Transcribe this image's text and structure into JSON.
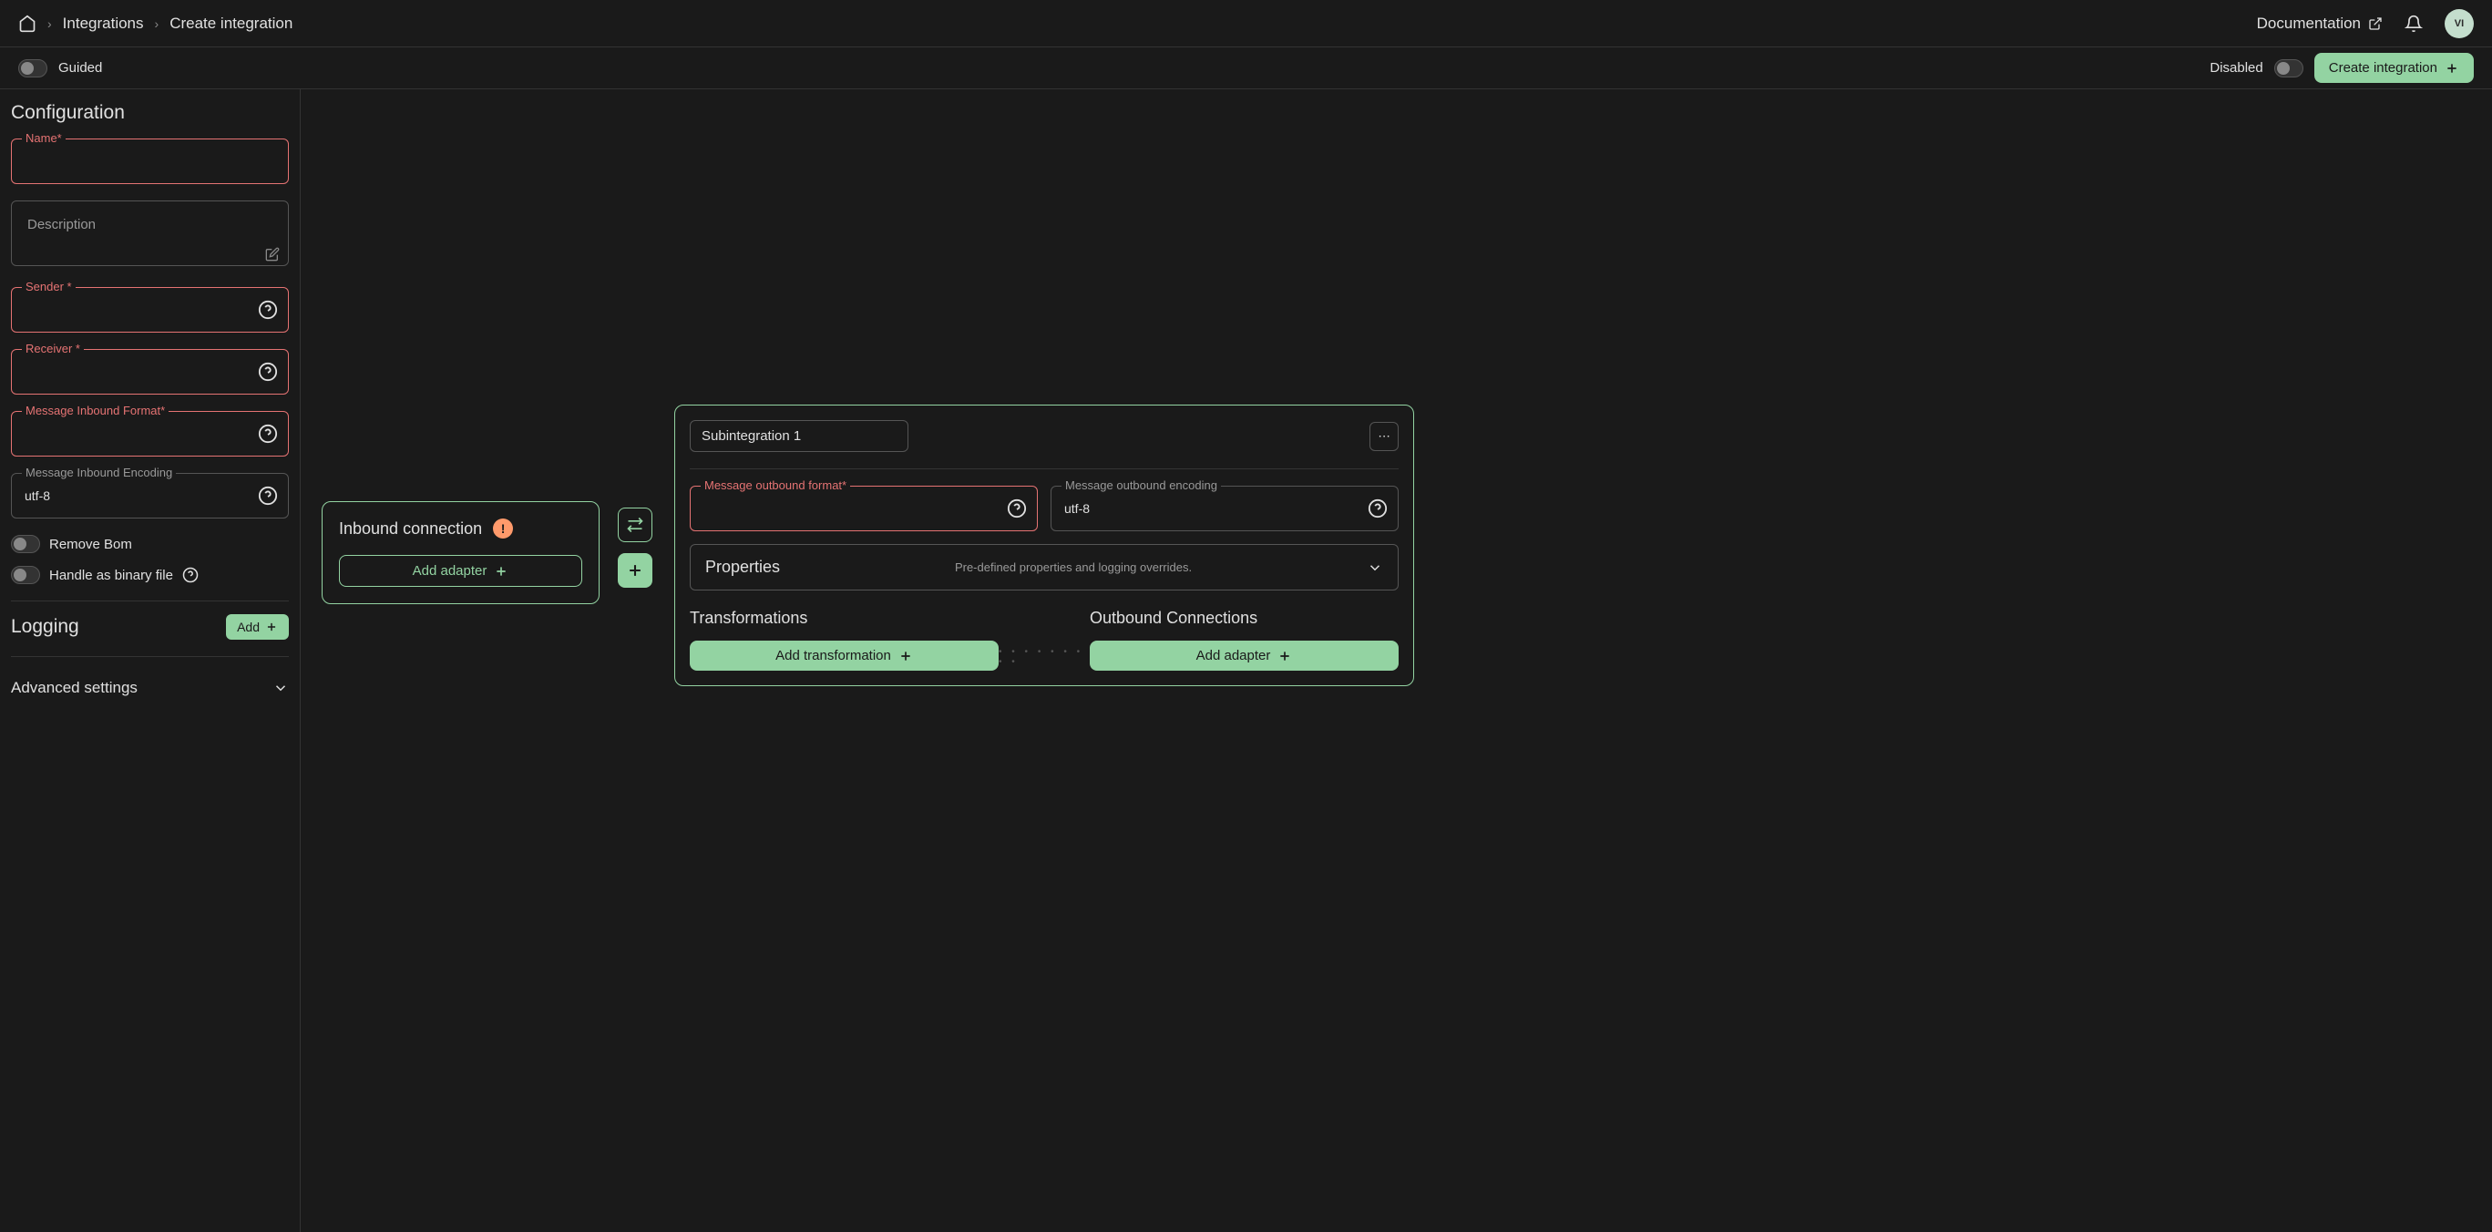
{
  "breadcrumb": {
    "items": [
      "Integrations",
      "Create integration"
    ]
  },
  "header": {
    "documentation_label": "Documentation",
    "avatar_initials": "VI"
  },
  "subheader": {
    "guided_label": "Guided",
    "disabled_label": "Disabled",
    "create_btn": "Create integration"
  },
  "sidebar": {
    "configuration_title": "Configuration",
    "name_label": "Name*",
    "description_label": "Description",
    "sender_label": "Sender *",
    "receiver_label": "Receiver *",
    "inbound_format_label": "Message Inbound Format*",
    "inbound_encoding_label": "Message Inbound Encoding",
    "inbound_encoding_value": "utf-8",
    "remove_bom_label": "Remove Bom",
    "handle_binary_label": "Handle as binary file",
    "logging_title": "Logging",
    "add_btn": "Add",
    "advanced_label": "Advanced settings"
  },
  "inbound": {
    "title": "Inbound connection",
    "add_adapter_btn": "Add adapter"
  },
  "subintegration": {
    "name_value": "Subintegration 1",
    "outbound_format_label": "Message outbound format*",
    "outbound_encoding_label": "Message outbound encoding",
    "outbound_encoding_value": "utf-8",
    "properties_label": "Properties",
    "properties_desc": "Pre-defined properties and logging overrides.",
    "transformations_title": "Transformations",
    "add_transformation_btn": "Add transformation",
    "outbound_connections_title": "Outbound Connections",
    "add_adapter_btn": "Add adapter"
  }
}
